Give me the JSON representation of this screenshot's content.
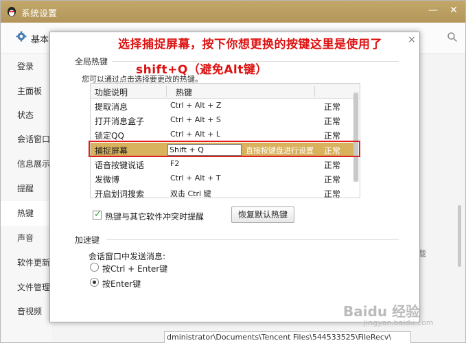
{
  "window": {
    "title": "系统设置",
    "minimize": "—",
    "close": "✕"
  },
  "tab": {
    "label": "基本"
  },
  "sidebar": {
    "items": [
      {
        "label": "登录"
      },
      {
        "label": "主面板"
      },
      {
        "label": "状态"
      },
      {
        "label": "会话窗口"
      },
      {
        "label": "信息展示"
      },
      {
        "label": "提醒"
      },
      {
        "label": "热键"
      },
      {
        "label": "声音"
      },
      {
        "label": "软件更新"
      },
      {
        "label": "文件管理"
      },
      {
        "label": "音视频"
      }
    ],
    "active_index": 6
  },
  "background": {
    "partial_text": "载",
    "path_value": "dministrator\\Documents\\Tencent Files\\544533525\\FileRecv\\"
  },
  "dialog": {
    "close": "×",
    "hotkey_section": "全局热键",
    "hotkey_desc": "您可以通过点击选择要更改的热键。",
    "table": {
      "headers": [
        "功能说明",
        "热键"
      ],
      "rows": [
        {
          "func": "提取消息",
          "key": "Ctrl + Alt + Z",
          "status": "正常"
        },
        {
          "func": "打开消息盒子",
          "key": "Ctrl + Alt + S",
          "status": "正常"
        },
        {
          "func": "锁定QQ",
          "key": "Ctrl + Alt + L",
          "status": "正常"
        },
        {
          "func": "捕捉屏幕",
          "key": "Shift + Q",
          "hint": "直接按键盘进行设置",
          "status": "正常"
        },
        {
          "func": "语音按键说话",
          "key": "F2",
          "status": "正常"
        },
        {
          "func": "发微博",
          "key": "Ctrl + Alt + T",
          "status": "正常"
        },
        {
          "func": "开启划词搜索",
          "key": "双击 Ctrl 键",
          "status": "正常"
        }
      ],
      "selected_index": 3
    },
    "conflict_checkbox": {
      "label": "热键与其它软件冲突时提醒",
      "checked": true
    },
    "restore_button": "恢复默认热键",
    "accel_section": "加速键",
    "send_label": "会话窗口中发送消息:",
    "radio_options": [
      {
        "label": "按Ctrl + Enter键",
        "selected": false
      },
      {
        "label": "按Enter键",
        "selected": true
      }
    ]
  },
  "annotation": {
    "line1": "选择捕捉屏幕，按下你想更换的按键这里是使用了",
    "line2": "shift+Q（避免Alt键）",
    "color": "#dd1111"
  },
  "watermark": {
    "logo": "Baidu 经验",
    "url": "jingyan.baidu.com"
  },
  "colors": {
    "titlebar": "#b8995c",
    "selected_row": "#d8b25c",
    "highlight_box": "#e02020"
  }
}
